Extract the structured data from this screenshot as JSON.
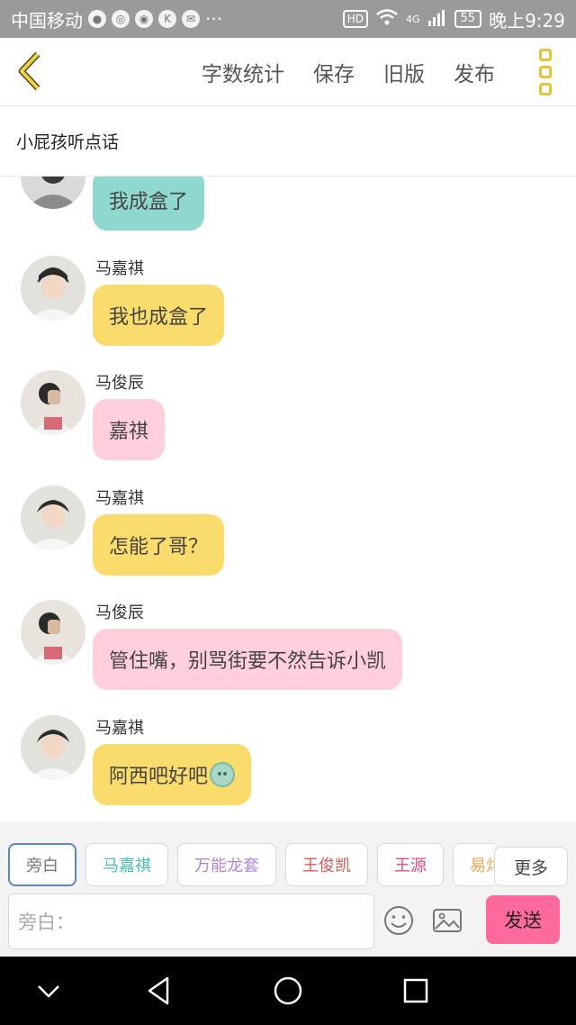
{
  "status_bar": {
    "carrier": "中国移动",
    "signal_label": "4G",
    "battery": "55",
    "time": "晚上9:29",
    "hd": "HD",
    "ellipsis": "···"
  },
  "header": {
    "actions": [
      "字数统计",
      "保存",
      "旧版",
      "发布"
    ]
  },
  "story_title": "小屁孩听点话",
  "messages": [
    {
      "sender": "",
      "text": "我成盒了",
      "bubble_color": "teal",
      "avatar": "teen-boy-grey"
    },
    {
      "sender": "马嘉祺",
      "text": "我也成盒了",
      "bubble_color": "yellow",
      "avatar": "boy-white"
    },
    {
      "sender": "马俊辰",
      "text": "嘉祺",
      "bubble_color": "pink",
      "avatar": "boy-covering-face"
    },
    {
      "sender": "马嘉祺",
      "text": "怎能了哥？",
      "bubble_color": "yellow",
      "avatar": "boy-white"
    },
    {
      "sender": "马俊辰",
      "text": "管住嘴，别骂街要不然告诉小凯",
      "bubble_color": "pink",
      "avatar": "boy-covering-face"
    },
    {
      "sender": "马嘉祺",
      "text": "阿西吧好吧",
      "bubble_color": "yellow",
      "avatar": "boy-white",
      "emoji": "sad-sweat-emoji"
    }
  ],
  "composer": {
    "roles": [
      "旁白",
      "马嘉祺",
      "万能龙套",
      "王俊凯",
      "王源",
      "易烊"
    ],
    "role_colors": [
      "#777777",
      "#45c0b3",
      "#b085d8",
      "#d45b5b",
      "#e04d8b",
      "#f2a04b"
    ],
    "more": "更多",
    "input_placeholder": "旁白：",
    "send": "发送"
  },
  "colors": {
    "teal": "#8fd8cf",
    "yellow": "#f9dc6b",
    "pink": "#ffcfdc",
    "send": "#ff6a9e",
    "accent": "#e8c23a"
  }
}
